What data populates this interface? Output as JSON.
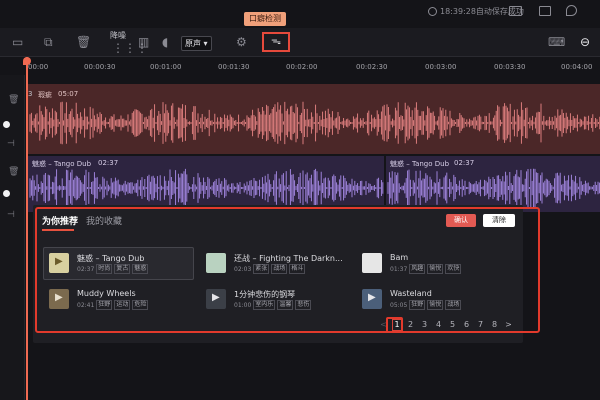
{
  "statusbar": {
    "save_status": "18:39:28自动保存成功"
  },
  "tooltip": {
    "text": "口癖检测"
  },
  "toolbar": {
    "denoise_label": "降噪",
    "voice_select": "原声",
    "icons": [
      "split-icon",
      "copy-icon",
      "delete-icon",
      "waveform-icon",
      "voice-change-icon",
      "mouth-detect-icon",
      "keyboard-icon",
      "zoom-out-icon"
    ]
  },
  "timeline": {
    "ticks": [
      "00:00",
      "00:00:30",
      "00:01:00",
      "00:01:30",
      "00:02:00",
      "00:02:30",
      "00:03:00",
      "00:03:30",
      "00:04:00"
    ]
  },
  "tracks": {
    "bgm": {
      "name": "瑕疵",
      "duration": "05:07",
      "color": "#e98585"
    },
    "music_a": {
      "name": "魅惑 – Tango Dub",
      "duration": "02:37",
      "color": "#a88be8"
    },
    "music_b": {
      "name": "魅惑 – Tango Dub",
      "duration": "02:37",
      "color": "#a88be8"
    }
  },
  "panel": {
    "tabs": [
      "为你推荐",
      "我的收藏"
    ],
    "confirm_label": "确认",
    "clear_label": "清除",
    "songs": [
      {
        "title": "魅惑 – Tango Dub",
        "duration": "02:37",
        "tags": [
          "时尚",
          "复古",
          "魅惑"
        ],
        "thumb_color": "#d8d0a0"
      },
      {
        "title": "还战 – Fighting The Darkn...",
        "duration": "02:03",
        "tags": [
          "紧张",
          "战场",
          "格斗"
        ],
        "thumb_color": "#b9d2c0"
      },
      {
        "title": "Bam",
        "duration": "01:37",
        "tags": [
          "风趣",
          "愉悦",
          "欢快"
        ],
        "thumb_color": "#e6e6e6"
      },
      {
        "title": "Muddy Wheels",
        "duration": "02:41",
        "tags": [
          "狂野",
          "运动",
          "危险"
        ],
        "thumb_color": "#7b6a4e"
      },
      {
        "title": "1分钟悲伤的钢琴",
        "duration": "01:00",
        "tags": [
          "室内乐",
          "温馨",
          "悲伤"
        ],
        "thumb_color": "#3b3f47"
      },
      {
        "title": "Wasteland",
        "duration": "05:05",
        "tags": [
          "狂野",
          "愉悦",
          "战场"
        ],
        "thumb_color": "#4b5f7a"
      }
    ],
    "pagination": {
      "prev": "<",
      "pages": [
        "1",
        "2",
        "3",
        "4",
        "5",
        "6",
        "7",
        "8"
      ],
      "current": "1",
      "next": ">"
    }
  }
}
